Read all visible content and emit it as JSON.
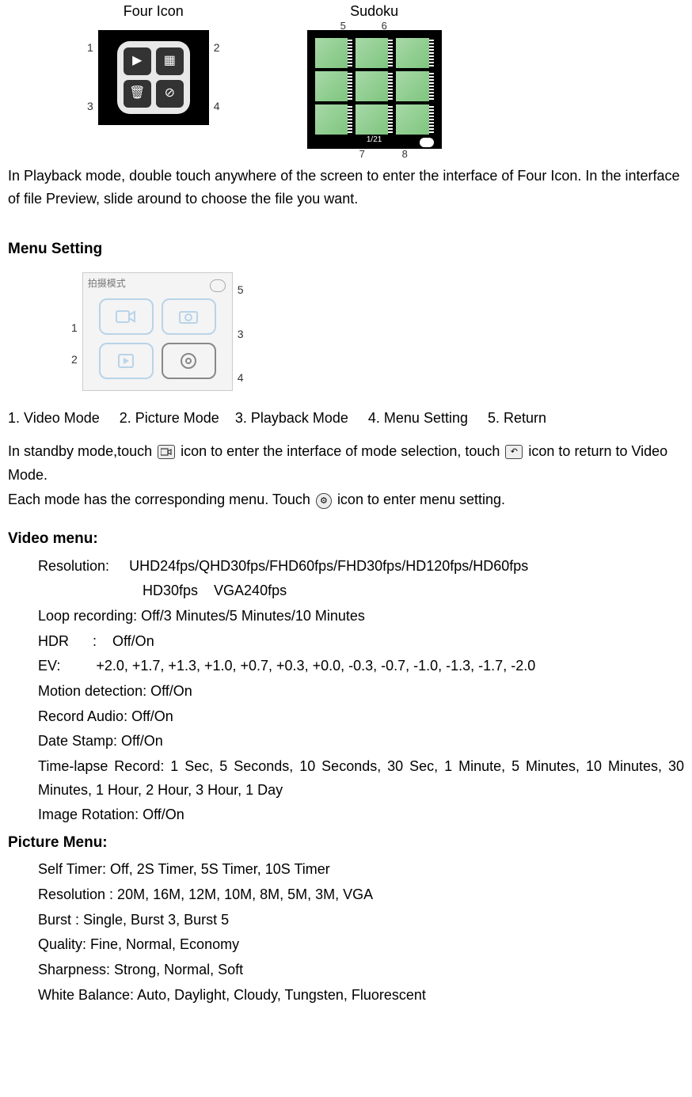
{
  "figures": {
    "four_icon_label": "Four Icon",
    "sudoku_label": "Sudoku",
    "four_icon_markers": [
      "1",
      "2",
      "3",
      "4"
    ],
    "sudoku_markers": {
      "m5": "5",
      "m6": "6",
      "m7": "7",
      "m8": "8"
    },
    "sudoku_pager": "1/21"
  },
  "playback_para": "In Playback mode, double touch anywhere of the screen to enter the interface of Four Icon. In the interface of file Preview, slide around to choose the file you want.",
  "menu_setting_head": "Menu Setting",
  "menu_setting_img_head": "拍摄模式",
  "menu_setting_markers": {
    "m1": "1",
    "m2": "2",
    "m3": "3",
    "m4": "4",
    "m5": "5"
  },
  "mode_list": "1. Video Mode     2. Picture Mode    3. Playback Mode     4. Menu Setting     5. Return",
  "standby_1": "In standby mode,touch ",
  "standby_2": " icon to enter the interface of mode selection, touch ",
  "standby_3": "icon to return to Video Mode.",
  "each_mode_1": "Each mode has the corresponding menu. Touch ",
  "each_mode_2": " icon to enter menu setting.",
  "video_menu_head": "Video menu:",
  "video_menu": {
    "resolution_label": "Resolution:",
    "resolution_l1": "UHD24fps/QHD30fps/FHD60fps/FHD30fps/HD120fps/HD60fps",
    "resolution_l2": "HD30fps    VGA240fps",
    "loop": "Loop recording: Off/3 Minutes/5 Minutes/10 Minutes",
    "hdr": "HDR      :    Off/On",
    "ev": "EV:         +2.0, +1.7, +1.3, +1.0, +0.7, +0.3, +0.0, -0.3, -0.7, -1.0, -1.3, -1.7, -2.0",
    "motion": "Motion detection: Off/On",
    "audio": "Record Audio: Off/On",
    "date": "Date Stamp: Off/On",
    "timelapse": "Time-lapse Record: 1 Sec, 5 Seconds, 10 Seconds, 30 Sec, 1 Minute, 5 Minutes, 10 Minutes, 30 Minutes, 1 Hour, 2 Hour, 3 Hour, 1 Day",
    "rotation": "Image Rotation: Off/On"
  },
  "picture_menu_head": "Picture Menu:",
  "picture_menu": {
    "self_timer": "Self Timer: Off, 2S Timer, 5S Timer, 10S Timer",
    "resolution": "Resolution : 20M, 16M, 12M, 10M, 8M, 5M, 3M, VGA",
    "burst": "Burst : Single, Burst 3, Burst 5",
    "quality": "Quality: Fine, Normal, Economy",
    "sharpness": "Sharpness: Strong, Normal, Soft",
    "wb": "White Balance: Auto, Daylight, Cloudy, Tungsten, Fluorescent"
  }
}
